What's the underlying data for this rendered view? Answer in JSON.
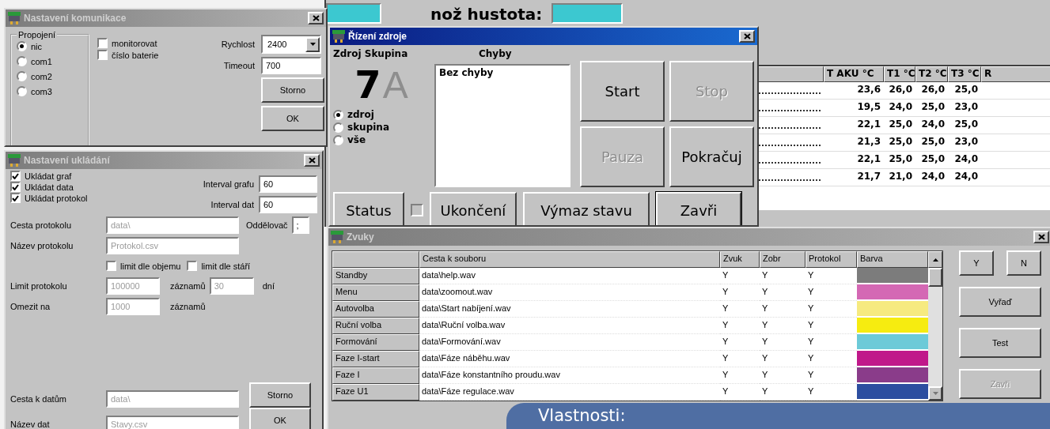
{
  "background_window": {
    "density_label": "nož hustota:",
    "table": {
      "columns": [
        "T AKU °C",
        "T1 °C",
        "T2 °C",
        "T3 °C",
        "R"
      ],
      "rows": [
        {
          "values": [
            "23,6",
            "26,0",
            "26,0",
            "25,0"
          ]
        },
        {
          "values": [
            "19,5",
            "24,0",
            "25,0",
            "23,0"
          ]
        },
        {
          "values": [
            "22,1",
            "25,0",
            "24,0",
            "25,0"
          ]
        },
        {
          "values": [
            "21,3",
            "25,0",
            "25,0",
            "23,0"
          ]
        },
        {
          "values": [
            "22,1",
            "25,0",
            "25,0",
            "24,0"
          ]
        },
        {
          "values": [
            "21,7",
            "21,0",
            "24,0",
            "24,0"
          ]
        }
      ]
    }
  },
  "communication_dialog": {
    "title": "Nastavení komunikace",
    "connection_group": {
      "label": "Propojení",
      "options": [
        {
          "label": "nic",
          "selected": true
        },
        {
          "label": "com1",
          "selected": false
        },
        {
          "label": "com2",
          "selected": false
        },
        {
          "label": "com3",
          "selected": false
        }
      ]
    },
    "checkboxes": [
      {
        "label": "monitorovat",
        "checked": false
      },
      {
        "label": "číslo baterie",
        "checked": false
      }
    ],
    "speed": {
      "label": "Rychlost",
      "value": "2400"
    },
    "timeout": {
      "label": "Timeout",
      "value": "700"
    },
    "buttons": [
      "Storno",
      "OK"
    ]
  },
  "storage_dialog": {
    "title": "Nastavení ukládání",
    "checkboxes": [
      {
        "label": "Ukládat graf",
        "checked": true
      },
      {
        "label": "Ukládat data",
        "checked": true
      },
      {
        "label": "Ukládat protokol",
        "checked": true
      }
    ],
    "graph_interval": {
      "label": "Interval grafu",
      "value": "60"
    },
    "data_interval": {
      "label": "Interval dat",
      "value": "60"
    },
    "protocol_path": {
      "label": "Cesta protokolu",
      "value": "data\\",
      "disabled": true
    },
    "separator": {
      "label": "Oddělovač",
      "value": ";"
    },
    "protocol_name": {
      "label": "Název protokolu",
      "value": "Protokol.csv",
      "disabled": true
    },
    "limit_checkboxes": [
      {
        "label": "limit dle objemu",
        "checked": false
      },
      {
        "label": "limit dle stáří",
        "checked": false
      }
    ],
    "protocol_limit": {
      "label": "Limit protokolu",
      "value": "100000",
      "unit": "záznamů",
      "age_value": "30",
      "age_unit": "dní",
      "disabled": true
    },
    "restrict": {
      "label": "Omezit na",
      "value": "1000",
      "unit": "záznamů",
      "disabled": true
    },
    "data_path": {
      "label": "Cesta k datům",
      "value": "data\\",
      "disabled": true
    },
    "data_name": {
      "label": "Název dat",
      "value": "Stavy.csv",
      "disabled": true
    },
    "buttons": [
      "Storno",
      "OK"
    ]
  },
  "power_dialog": {
    "title": "Řízení zdroje",
    "source_group_label": "Zdroj Skupina",
    "errors_label": "Chyby",
    "source_number": "7",
    "group_letter": "A",
    "errors": [
      "Bez chyby"
    ],
    "scope_options": [
      {
        "label": "zdroj",
        "selected": true
      },
      {
        "label": "skupina",
        "selected": false
      },
      {
        "label": "vše",
        "selected": false
      }
    ],
    "action_buttons": [
      {
        "label": "Start",
        "disabled": false
      },
      {
        "label": "Stop",
        "disabled": true
      },
      {
        "label": "Pauza",
        "disabled": true
      },
      {
        "label": "Pokračuj",
        "disabled": false
      }
    ],
    "status_button": "Status",
    "end_toggle": {
      "label": "Ukončení",
      "checked": false
    },
    "clear_button": "Výmaz stavu",
    "close_button": "Zavři"
  },
  "sounds_dialog": {
    "title": "Zvuky",
    "columns": [
      "Cesta k souboru",
      "Zvuk",
      "Zobr",
      "Protokol",
      "Barva"
    ],
    "rows": [
      {
        "name": "Standby",
        "path": "data\\help.wav",
        "sound": "Y",
        "display": "Y",
        "protocol": "Y",
        "color": "#7c7c7c"
      },
      {
        "name": "Menu",
        "path": "data\\zoomout.wav",
        "sound": "Y",
        "display": "Y",
        "protocol": "Y",
        "color": "#d468b4"
      },
      {
        "name": "Autovolba",
        "path": "data\\Start nabíjení.wav",
        "sound": "Y",
        "display": "Y",
        "protocol": "Y",
        "color": "#f6ea80"
      },
      {
        "name": "Ruční volba",
        "path": "data\\Ruční volba.wav",
        "sound": "Y",
        "display": "Y",
        "protocol": "Y",
        "color": "#f6ec10"
      },
      {
        "name": "Formování",
        "path": "data\\Formování.wav",
        "sound": "Y",
        "display": "Y",
        "protocol": "Y",
        "color": "#6ccad8"
      },
      {
        "name": "Faze I-start",
        "path": "data\\Fáze náběhu.wav",
        "sound": "Y",
        "display": "Y",
        "protocol": "Y",
        "color": "#c0188a"
      },
      {
        "name": "Faze I",
        "path": "data\\Fáze konstantního proudu.wav",
        "sound": "Y",
        "display": "Y",
        "protocol": "Y",
        "color": "#8a3c8a"
      },
      {
        "name": "Faze U1",
        "path": "data\\Fáze regulace.wav",
        "sound": "Y",
        "display": "Y",
        "protocol": "Y",
        "color": "#2c4ea0"
      }
    ],
    "buttons": [
      {
        "label": "Y",
        "disabled": false
      },
      {
        "label": "N",
        "disabled": false
      },
      {
        "label": "Vyřaď",
        "disabled": false
      },
      {
        "label": "Test",
        "disabled": false
      },
      {
        "label": "Zavři",
        "disabled": true
      }
    ]
  },
  "overlay": {
    "caption": "Vlastnosti:"
  }
}
